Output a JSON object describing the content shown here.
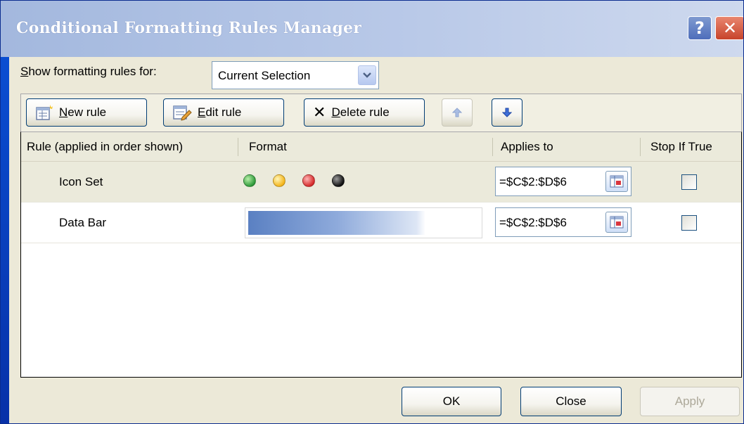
{
  "window": {
    "title": "Conditional Formatting Rules Manager",
    "help_glyph": "?",
    "close_glyph": "✕"
  },
  "filter": {
    "label_prefix": "",
    "label_mnemonic": "S",
    "label_rest": "how formatting rules for:",
    "selected": "Current Selection"
  },
  "toolbar": {
    "new_mnemonic": "N",
    "new_rest": "ew rule",
    "edit_mnemonic": "E",
    "edit_rest": "dit rule",
    "delete_mnemonic": "D",
    "delete_rest": "elete rule",
    "delete_glyph": "✕"
  },
  "columns": {
    "rule": "Rule (applied in order shown)",
    "format": "Format",
    "applies_to": "Applies to",
    "stop_if_true": "Stop If True"
  },
  "rules": [
    {
      "name": "Icon Set",
      "format_type": "icon-set",
      "icons": [
        "green-circle",
        "yellow-circle",
        "red-circle",
        "black-circle"
      ],
      "icon_colors": [
        "#2f9a3a",
        "#f4b51b",
        "#d52b2b",
        "#111111"
      ],
      "applies_to": "=$C$2:$D$6",
      "stop_if_true": false
    },
    {
      "name": "Data Bar",
      "format_type": "data-bar",
      "bar_color": "#5a80c2",
      "applies_to": "=$C$2:$D$6",
      "stop_if_true": false
    }
  ],
  "footer": {
    "ok": "OK",
    "close": "Close",
    "apply": "Apply"
  }
}
